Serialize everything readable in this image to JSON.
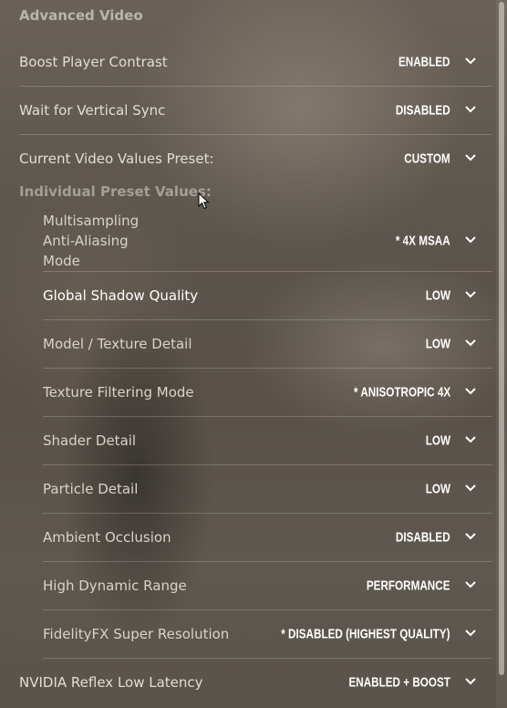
{
  "section": {
    "title": "Advanced Video",
    "subtitle": "Individual Preset Values:"
  },
  "settings": [
    {
      "label": "Boost Player Contrast",
      "value": "ENABLED"
    },
    {
      "label": "Wait for Vertical Sync",
      "value": "DISABLED"
    },
    {
      "label": "Current Video Values Preset:",
      "value": "CUSTOM"
    }
  ],
  "preset_values": [
    {
      "label_lines": [
        "Multisampling",
        "Anti-Aliasing",
        "Mode"
      ],
      "value": "* 4X MSAA"
    },
    {
      "label": "Global Shadow Quality",
      "value": "LOW"
    },
    {
      "label": "Model / Texture Detail",
      "value": "LOW"
    },
    {
      "label": "Texture Filtering Mode",
      "value": "* ANISOTROPIC 4X"
    },
    {
      "label": "Shader Detail",
      "value": "LOW"
    },
    {
      "label": "Particle Detail",
      "value": "LOW"
    },
    {
      "label": "Ambient Occlusion",
      "value": "DISABLED"
    },
    {
      "label": "High Dynamic Range",
      "value": "PERFORMANCE"
    },
    {
      "label": "FidelityFX Super Resolution",
      "value": "* DISABLED (HIGHEST QUALITY)"
    }
  ],
  "footer_setting": {
    "label": "NVIDIA Reflex Low Latency",
    "value": "ENABLED + BOOST"
  },
  "icons": {
    "dropdown": "chevron-down-icon",
    "cursor": "mouse-pointer-icon"
  },
  "colors": {
    "value_text": "#ffffff",
    "label_text": "#e2ddd4",
    "divider": "rgba(220,215,205,0.25)"
  }
}
